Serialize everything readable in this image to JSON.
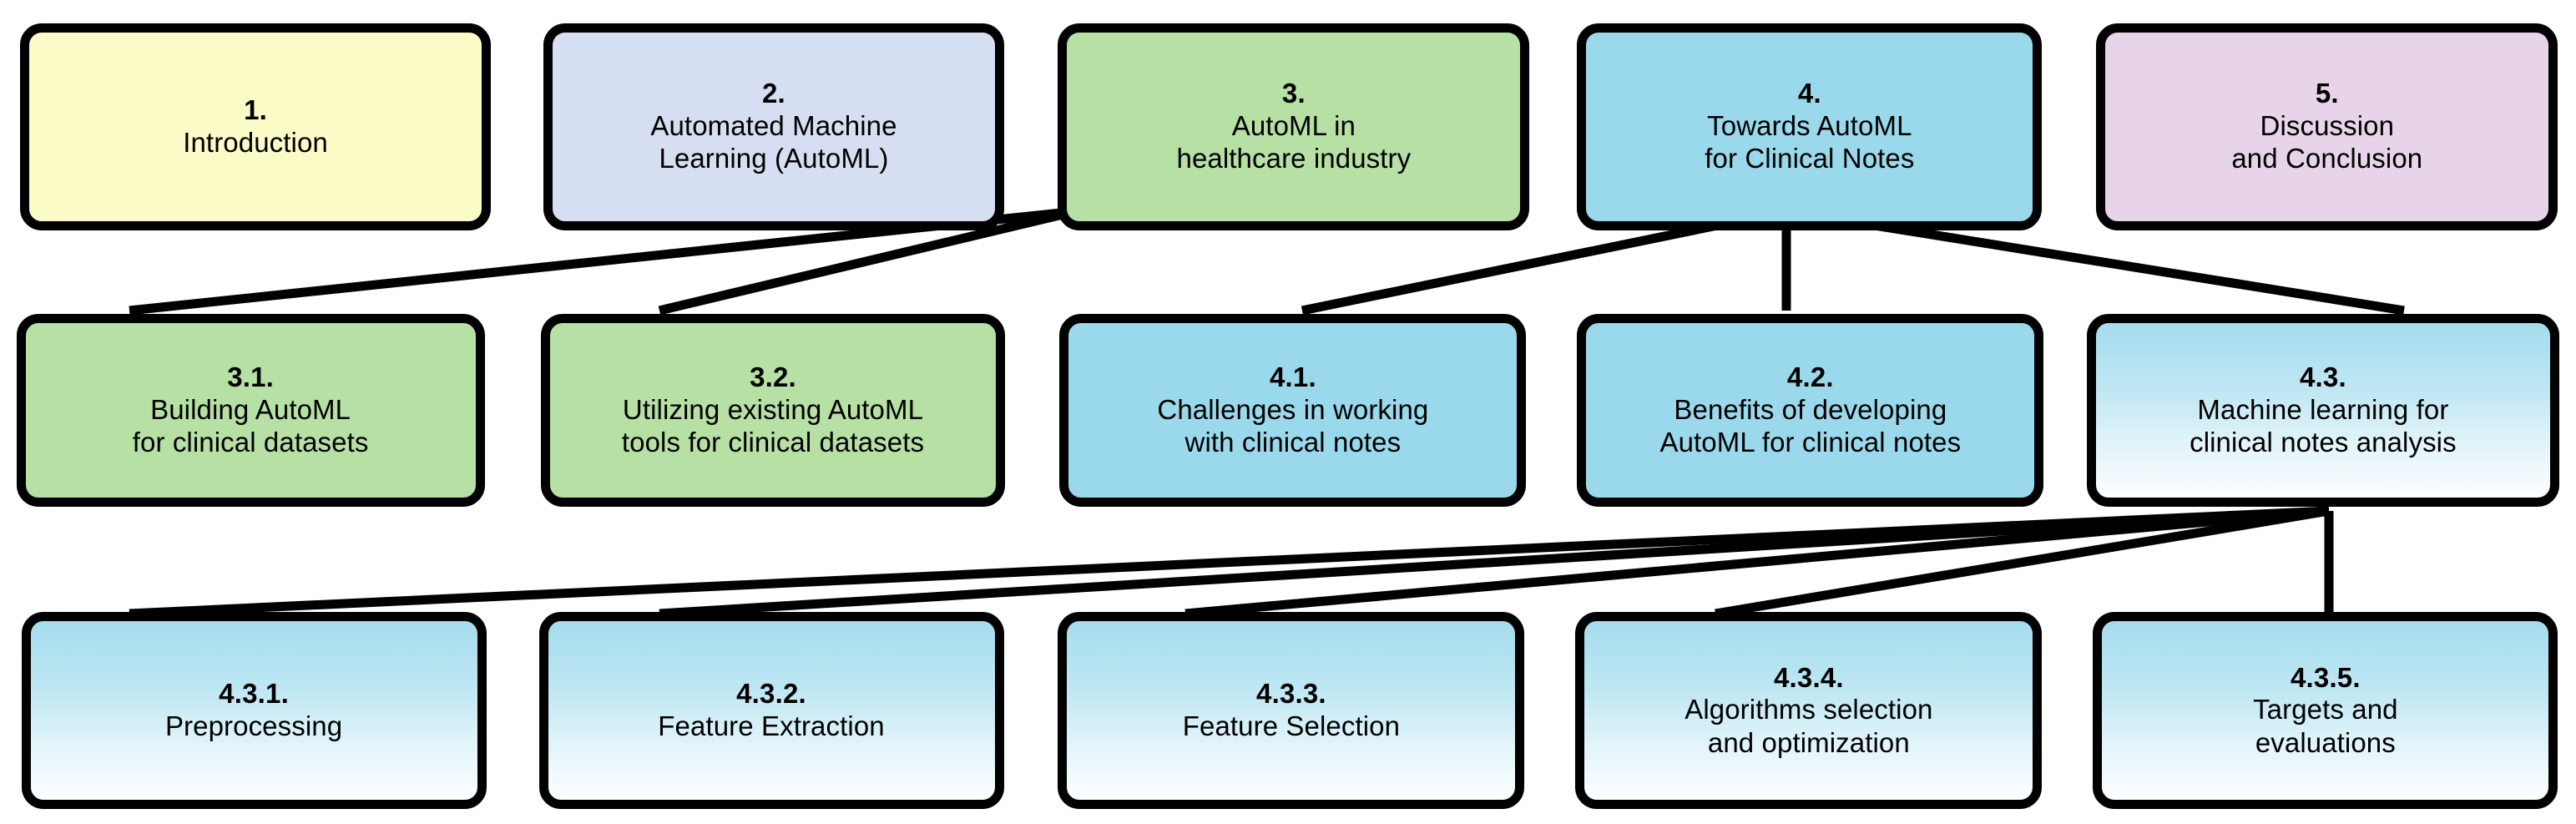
{
  "diagram": {
    "type": "hierarchical-flow-diagram",
    "background_color": "#ffffff",
    "border_color": "#000000",
    "palette": {
      "yellow": "#fbfbc8",
      "lavender": "#d6dff2",
      "green": "#b6e0a4",
      "blue": "#9ad9eb",
      "pink": "#e8d4e8",
      "gradient_top": "#a5dced",
      "gradient_bottom": "#ffffff"
    },
    "rows": [
      {
        "name": "top-level-sections",
        "nodes": [
          {
            "id": "n1",
            "number": "1.",
            "title": "Introduction",
            "fill": "yellow"
          },
          {
            "id": "n2",
            "number": "2.",
            "title": "Automated Machine\nLearning (AutoML)",
            "fill": "lavender"
          },
          {
            "id": "n3",
            "number": "3.",
            "title": "AutoML in\nhealthcare industry",
            "fill": "green"
          },
          {
            "id": "n4",
            "number": "4.",
            "title": "Towards AutoML\nfor  Clinical Notes",
            "fill": "blue"
          },
          {
            "id": "n5",
            "number": "5.",
            "title": "Discussion\nand  Conclusion",
            "fill": "pink"
          }
        ]
      },
      {
        "name": "second-level-subsections",
        "nodes": [
          {
            "id": "n31",
            "number": "3.1.",
            "title": "Building AutoML\nfor clinical datasets",
            "fill": "green"
          },
          {
            "id": "n32",
            "number": "3.2.",
            "title": "Utilizing existing AutoML\ntools for  clinical  datasets",
            "fill": "green"
          },
          {
            "id": "n41",
            "number": "4.1.",
            "title": "Challenges in working\nwith  clinical notes",
            "fill": "blue"
          },
          {
            "id": "n42",
            "number": "4.2.",
            "title": "Benefits of developing\nAutoML for clinical notes",
            "fill": "blue"
          },
          {
            "id": "n43",
            "number": "4.3.",
            "title": "Machine learning for\nclinical  notes analysis",
            "fill": "gradient"
          }
        ]
      },
      {
        "name": "third-level-subsections",
        "nodes": [
          {
            "id": "n431",
            "number": "4.3.1.",
            "title": "Preprocessing",
            "fill": "gradient"
          },
          {
            "id": "n432",
            "number": "4.3.2.",
            "title": "Feature  Extraction",
            "fill": "gradient"
          },
          {
            "id": "n433",
            "number": "4.3.3.",
            "title": "Feature Selection",
            "fill": "gradient"
          },
          {
            "id": "n434",
            "number": "4.3.4.",
            "title": "Algorithms selection\nand optimization",
            "fill": "gradient"
          },
          {
            "id": "n435",
            "number": "4.3.5.",
            "title": "Targets and\nevaluations",
            "fill": "gradient"
          }
        ]
      }
    ],
    "edges": [
      {
        "from": "n3",
        "to": "n31"
      },
      {
        "from": "n3",
        "to": "n32"
      },
      {
        "from": "n4",
        "to": "n41"
      },
      {
        "from": "n4",
        "to": "n42"
      },
      {
        "from": "n4",
        "to": "n43"
      },
      {
        "from": "n43",
        "to": "n431"
      },
      {
        "from": "n43",
        "to": "n432"
      },
      {
        "from": "n43",
        "to": "n433"
      },
      {
        "from": "n43",
        "to": "n434"
      },
      {
        "from": "n43",
        "to": "n435"
      }
    ]
  }
}
